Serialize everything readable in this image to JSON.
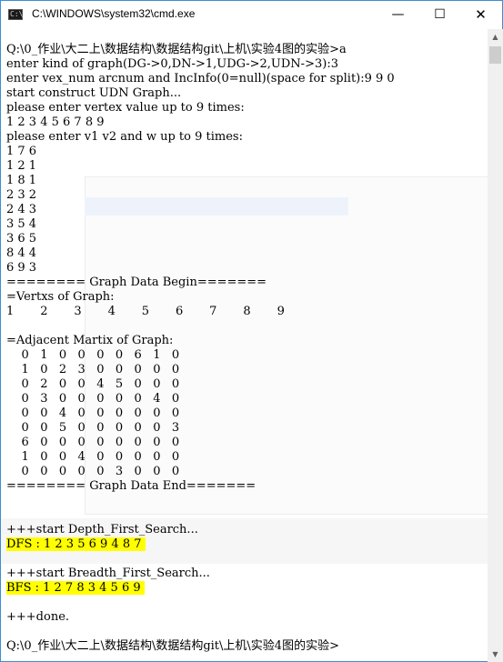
{
  "window": {
    "title": "C:\\WINDOWS\\system32\\cmd.exe",
    "icon_label": "C:\\",
    "buttons": {
      "minimize": "—",
      "maximize": "☐",
      "close": "✕"
    }
  },
  "console": {
    "lines": [
      "Q:\\0_作业\\大二上\\数据结构\\数据结构git\\上机\\实验4图的实验>a",
      "enter kind of graph(DG->0,DN->1,UDG->2,UDN->3):3",
      "enter vex_num arcnum and IncInfo(0=null)(space for split):9 9 0",
      "start construct UDN Graph...",
      "please enter vertex value up to 9 times:",
      "1 2 3 4 5 6 7 8 9",
      "please enter v1 v2 and w up to 9 times:",
      "1 7 6",
      "1 2 1",
      "1 8 1",
      "2 3 2",
      "2 4 3",
      "3 5 4",
      "3 6 5",
      "8 4 4",
      "6 9 3",
      "======== Graph Data Begin=======",
      "=Vertxs of Graph:",
      "1       2       3       4       5       6       7       8       9",
      "",
      "=Adjacent Martix of Graph:",
      "    0   1   0   0   0   0   6   1   0",
      "    1   0   2   3   0   0   0   0   0",
      "    0   2   0   0   4   5   0   0   0",
      "    0   3   0   0   0   0   0   4   0",
      "    0   0   4   0   0   0   0   0   0",
      "    0   0   5   0   0   0   0   0   3",
      "    6   0   0   0   0   0   0   0   0",
      "    1   0   0   4   0   0   0   0   0",
      "    0   0   0   0   0   3   0   0   0",
      "======== Graph Data End=======",
      "",
      "",
      "+++start Depth_First_Search...",
      "DFS : 1 2 3 5 6 9 4 8 7 ",
      "",
      "+++start Breadth_First_Search...",
      "BFS : 1 2 7 8 3 4 5 6 9 ",
      "",
      "+++done.",
      "",
      "Q:\\0_作业\\大二上\\数据结构\\数据结构git\\上机\\实验4图的实验>"
    ]
  },
  "scrollbar": {
    "up_arrow": "▲",
    "down_arrow": "▼"
  }
}
